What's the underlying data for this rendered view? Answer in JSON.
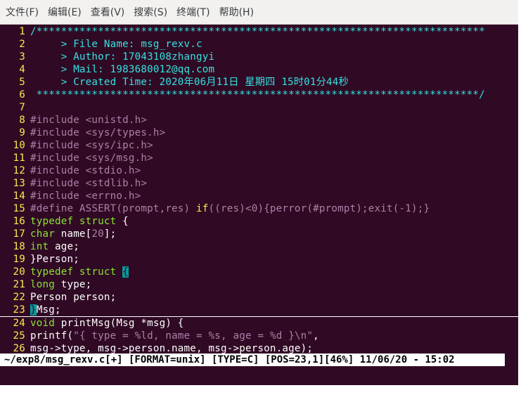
{
  "menu": [
    "文件(F)",
    "编辑(E)",
    "查看(V)",
    "搜索(S)",
    "终端(T)",
    "帮助(H)"
  ],
  "lines": [
    {
      "n": "1",
      "tokens": [
        {
          "t": "/*************************************************************************",
          "c": "comment"
        }
      ]
    },
    {
      "n": "2",
      "tokens": [
        {
          "t": "     > File Name: msg_rexv.c",
          "c": "comment"
        }
      ]
    },
    {
      "n": "3",
      "tokens": [
        {
          "t": "     > Author: 17043108zhangyi",
          "c": "comment"
        }
      ]
    },
    {
      "n": "4",
      "tokens": [
        {
          "t": "     > Mail: 1983680012@qq.com",
          "c": "comment"
        }
      ]
    },
    {
      "n": "5",
      "tokens": [
        {
          "t": "     > Created Time: 2020年06月11日 星期四 15时01分44秒",
          "c": "comment"
        }
      ]
    },
    {
      "n": "6",
      "tokens": [
        {
          "t": " ************************************************************************/",
          "c": "comment"
        }
      ]
    },
    {
      "n": "7",
      "tokens": []
    },
    {
      "n": "8",
      "tokens": [
        {
          "t": "#include ",
          "c": "pre"
        },
        {
          "t": "<unistd.h>",
          "c": "str"
        }
      ]
    },
    {
      "n": "9",
      "tokens": [
        {
          "t": "#include ",
          "c": "pre"
        },
        {
          "t": "<sys/types.h>",
          "c": "str"
        }
      ]
    },
    {
      "n": "10",
      "tokens": [
        {
          "t": "#include ",
          "c": "pre"
        },
        {
          "t": "<sys/ipc.h>",
          "c": "str"
        }
      ]
    },
    {
      "n": "11",
      "tokens": [
        {
          "t": "#include ",
          "c": "pre"
        },
        {
          "t": "<sys/msg.h>",
          "c": "str"
        }
      ]
    },
    {
      "n": "12",
      "tokens": [
        {
          "t": "#include ",
          "c": "pre"
        },
        {
          "t": "<stdio.h>",
          "c": "str"
        }
      ]
    },
    {
      "n": "13",
      "tokens": [
        {
          "t": "#include ",
          "c": "pre"
        },
        {
          "t": "<stdlib.h>",
          "c": "str"
        }
      ]
    },
    {
      "n": "14",
      "tokens": [
        {
          "t": "#include ",
          "c": "pre"
        },
        {
          "t": "<errno.h>",
          "c": "str"
        }
      ]
    },
    {
      "n": "15",
      "tokens": [
        {
          "t": "#define ASSERT(prompt,res) ",
          "c": "pre"
        },
        {
          "t": "if",
          "c": "kw"
        },
        {
          "t": "((res)<0){perror(#prompt);exit(-1);}",
          "c": "pre"
        }
      ]
    },
    {
      "n": "16",
      "tokens": [
        {
          "t": "typedef struct",
          "c": "type"
        },
        {
          "t": " {",
          "c": "plain"
        }
      ]
    },
    {
      "n": "17",
      "tokens": [
        {
          "t": "char",
          "c": "type"
        },
        {
          "t": " name[",
          "c": "plain"
        },
        {
          "t": "20",
          "c": "num"
        },
        {
          "t": "];",
          "c": "plain"
        }
      ]
    },
    {
      "n": "18",
      "tokens": [
        {
          "t": "int",
          "c": "type"
        },
        {
          "t": " age;",
          "c": "plain"
        }
      ]
    },
    {
      "n": "19",
      "tokens": [
        {
          "t": "}Person;",
          "c": "plain"
        }
      ]
    },
    {
      "n": "20",
      "tokens": [
        {
          "t": "typedef struct",
          "c": "type"
        },
        {
          "t": " ",
          "c": "plain"
        },
        {
          "t": "{",
          "c": "match"
        }
      ]
    },
    {
      "n": "21",
      "tokens": [
        {
          "t": "long",
          "c": "type"
        },
        {
          "t": " type;",
          "c": "plain"
        }
      ]
    },
    {
      "n": "22",
      "tokens": [
        {
          "t": "Person person;",
          "c": "plain"
        }
      ]
    },
    {
      "n": "23",
      "cursor": true,
      "tokens": [
        {
          "t": "}",
          "c": "match"
        },
        {
          "t": "Msg;",
          "c": "plain"
        }
      ]
    },
    {
      "n": "24",
      "tokens": [
        {
          "t": "void",
          "c": "type"
        },
        {
          "t": " printMsg(Msg *msg) {",
          "c": "plain"
        }
      ]
    },
    {
      "n": "25",
      "tokens": [
        {
          "t": "printf(",
          "c": "plain"
        },
        {
          "t": "\"{ type = ",
          "c": "str"
        },
        {
          "t": "%ld",
          "c": "pre"
        },
        {
          "t": ", name = ",
          "c": "str"
        },
        {
          "t": "%s",
          "c": "pre"
        },
        {
          "t": ", age = ",
          "c": "str"
        },
        {
          "t": "%d",
          "c": "pre"
        },
        {
          "t": " }",
          "c": "str"
        },
        {
          "t": "\\n",
          "c": "pre"
        },
        {
          "t": "\"",
          "c": "str"
        },
        {
          "t": ",",
          "c": "plain"
        }
      ]
    },
    {
      "n": "26",
      "tokens": [
        {
          "t": "msg->type, msg->person.name, msg->person.age);",
          "c": "plain"
        }
      ]
    }
  ],
  "status_line": "~/exp8/msg_rexv.c[+] [FORMAT=unix] [TYPE=C] [POS=23,1][46%] 11/06/20 - 15:02",
  "colors": {
    "background": "#300a24",
    "line_number": "#fce94f",
    "comment": "#34e2e2",
    "preprocessor": "#ad7fa8",
    "type_keyword": "#8ae234",
    "statement_keyword": "#fce94f",
    "match_paren": "#06989a"
  }
}
